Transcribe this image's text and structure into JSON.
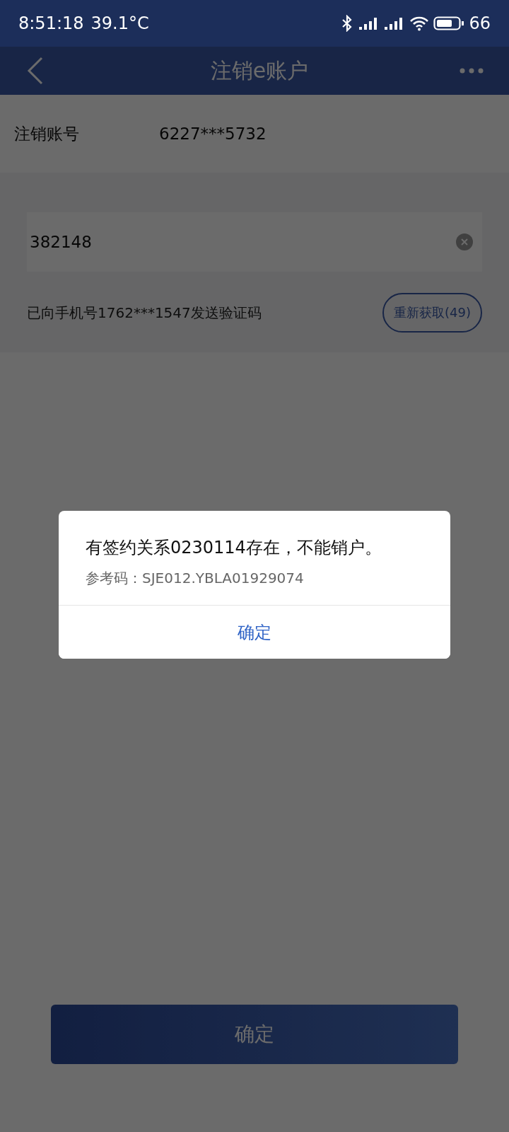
{
  "status_bar": {
    "time": "8:51:18",
    "temperature": "39.1°C",
    "battery": "66"
  },
  "header": {
    "title": "注销e账户"
  },
  "account": {
    "label": "注销账号",
    "value": "6227***5732"
  },
  "code_field": {
    "value": "382148"
  },
  "sms_notice": "已向手机号1762***1547发送验证码",
  "resend_button": {
    "label": "重新获取(49)"
  },
  "dialog": {
    "message": "有签约关系0230114存在，不能销户。",
    "reference": "参考码：SJE012.YBLA01929074",
    "button": "确定"
  },
  "confirm_button": {
    "label": "确定"
  }
}
